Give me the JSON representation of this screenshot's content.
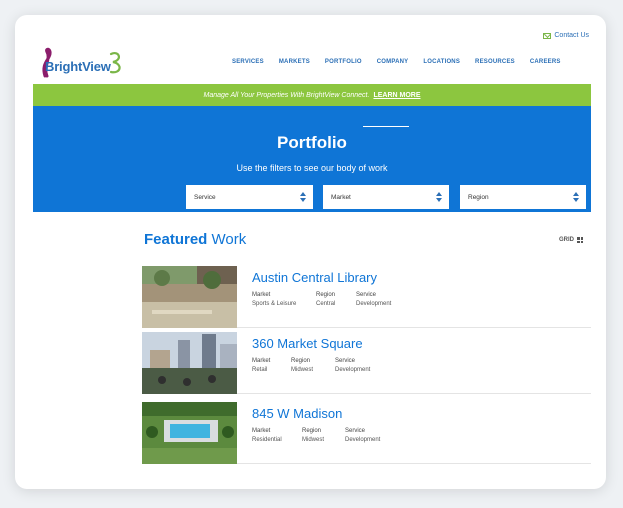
{
  "header": {
    "contact_label": "Contact Us",
    "logo_text": "BrightView",
    "nav": [
      "SERVICES",
      "MARKETS",
      "PORTFOLIO",
      "COMPANY",
      "LOCATIONS",
      "RESOURCES",
      "CAREERS"
    ]
  },
  "banner": {
    "text": "Manage All Your Properties With BrightView Connect.",
    "link": "LEARN MORE"
  },
  "hero": {
    "title": "Portfolio",
    "subtitle": "Use the filters to see our body of work",
    "filters": [
      "Service",
      "Market",
      "Region"
    ]
  },
  "featured": {
    "title_bold": "Featured",
    "title_rest": "Work",
    "view_label": "GRID"
  },
  "projects": [
    {
      "name": "Austin Central Library",
      "fields": [
        {
          "label": "Market",
          "value": "Sports & Leisure"
        },
        {
          "label": "Region",
          "value": "Central"
        },
        {
          "label": "Service",
          "value": "Development"
        }
      ]
    },
    {
      "name": "360 Market Square",
      "fields": [
        {
          "label": "Market",
          "value": "Retail"
        },
        {
          "label": "Region",
          "value": "Midwest"
        },
        {
          "label": "Service",
          "value": "Development"
        }
      ]
    },
    {
      "name": "845 W Madison",
      "fields": [
        {
          "label": "Market",
          "value": "Residential"
        },
        {
          "label": "Region",
          "value": "Midwest"
        },
        {
          "label": "Service",
          "value": "Development"
        }
      ]
    }
  ],
  "colors": {
    "brand_blue": "#0f75d6",
    "link_blue": "#2b6fb6",
    "banner_green": "#8cc63f",
    "logo_purple": "#8b1d6b"
  }
}
